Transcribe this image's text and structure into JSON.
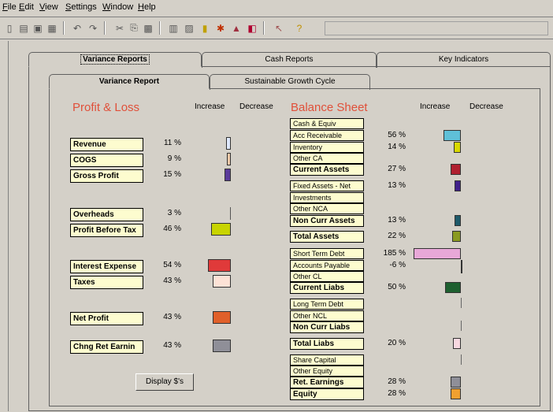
{
  "menu": [
    "File",
    "Edit",
    "View",
    "Settings",
    "Window",
    "Help"
  ],
  "menu_mnemonic": [
    "F",
    "E",
    "V",
    "S",
    "W",
    "H"
  ],
  "tabs_outer": [
    "Variance Reports",
    "Cash Reports",
    "Key Indicators"
  ],
  "tabs_inner": [
    "Variance Report",
    "Sustainable Growth Cycle"
  ],
  "pl": {
    "title": "Profit & Loss",
    "increase": "Increase",
    "decrease": "Decrease",
    "rows": [
      {
        "label": "Revenue",
        "pct": "11 %",
        "color": "#dfe9ff",
        "value": 11
      },
      {
        "label": "COGS",
        "pct": "9 %",
        "color": "#f2c9a8",
        "value": 9
      },
      {
        "label": "Gross Profit",
        "pct": "15 %",
        "color": "#5a3a9a",
        "value": 15
      },
      {
        "label": "Overheads",
        "pct": "3 %",
        "color": "#555555",
        "value": 3
      },
      {
        "label": "Profit Before Tax",
        "pct": "46 %",
        "color": "#c8d400",
        "value": 46
      },
      {
        "label": "Interest Expense",
        "pct": "54 %",
        "color": "#e03a3a",
        "value": 54
      },
      {
        "label": "Taxes",
        "pct": "43 %",
        "color": "#fde2d6",
        "value": 43
      },
      {
        "label": "Net Profit",
        "pct": "43 %",
        "color": "#e0602a",
        "value": 43
      },
      {
        "label": "Chng Ret Earnin",
        "pct": "43 %",
        "color": "#8f8f98",
        "value": 43
      }
    ]
  },
  "bs": {
    "title": "Balance Sheet",
    "increase": "Increase",
    "decrease": "Decrease",
    "rows": [
      {
        "label": "Cash & Equiv",
        "bold": false,
        "pct": "",
        "color": "",
        "value": 0
      },
      {
        "label": "Acc Receivable",
        "bold": false,
        "pct": "56 %",
        "color": "#5fc0d8",
        "value": 56
      },
      {
        "label": "Inventory",
        "bold": false,
        "pct": "14 %",
        "color": "#d8d800",
        "value": 14
      },
      {
        "label": "Other CA",
        "bold": false,
        "pct": "",
        "color": "",
        "value": 0
      },
      {
        "label": "Current Assets",
        "bold": true,
        "pct": "27 %",
        "color": "#b02030",
        "value": 27
      },
      {
        "label": "Fixed Assets - Net",
        "bold": false,
        "pct": "13 %",
        "color": "#40208a",
        "value": 13
      },
      {
        "label": "Investments",
        "bold": false,
        "pct": "",
        "color": "",
        "value": 0
      },
      {
        "label": "Other NCA",
        "bold": false,
        "pct": "",
        "color": "",
        "value": 0
      },
      {
        "label": "Non Curr Assets",
        "bold": true,
        "pct": "13 %",
        "color": "#1e5a6a",
        "value": 13
      },
      {
        "label": "Total Assets",
        "bold": true,
        "pct": "22 %",
        "color": "#8a9a20",
        "value": 22
      },
      {
        "label": "Short Term Debt",
        "bold": false,
        "pct": "185 %",
        "color": "#e8a8d8",
        "value": 185
      },
      {
        "label": "Accounts Payable",
        "bold": false,
        "pct": "-6 %",
        "color": "#d8d8d8",
        "value": -6
      },
      {
        "label": "Other CL",
        "bold": false,
        "pct": "",
        "color": "",
        "value": 0
      },
      {
        "label": "Current Liabs",
        "bold": true,
        "pct": "50 %",
        "color": "#1e6030",
        "value": 50
      },
      {
        "label": "Long Term Debt",
        "bold": false,
        "pct": "",
        "color": "",
        "value": 0
      },
      {
        "label": "Other NCL",
        "bold": false,
        "pct": "",
        "color": "",
        "value": 0
      },
      {
        "label": "Non Curr Liabs",
        "bold": true,
        "pct": "",
        "color": "",
        "value": 0
      },
      {
        "label": "Total Liabs",
        "bold": true,
        "pct": "20 %",
        "color": "#f8d8e0",
        "value": 20
      },
      {
        "label": "Share Capital",
        "bold": false,
        "pct": "",
        "color": "",
        "value": 0
      },
      {
        "label": "Other Equity",
        "bold": false,
        "pct": "",
        "color": "",
        "value": 0
      },
      {
        "label": "Ret. Earnings",
        "bold": true,
        "pct": "28 %",
        "color": "#8f8f98",
        "value": 28
      },
      {
        "label": "Equity",
        "bold": true,
        "pct": "28 %",
        "color": "#f0a030",
        "value": 28
      }
    ]
  },
  "display_button": "Display $'s"
}
